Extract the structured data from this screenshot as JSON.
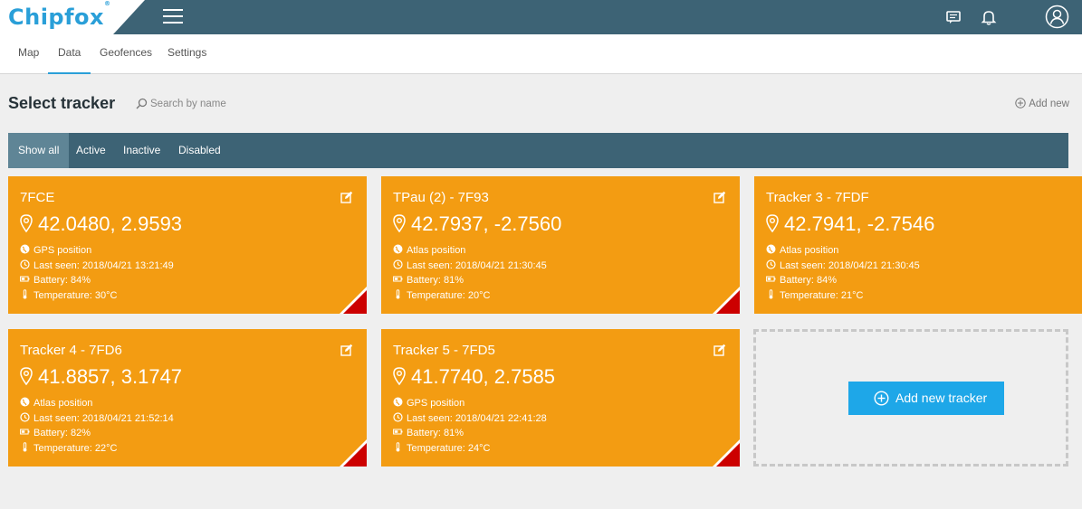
{
  "header": {
    "logo_text": "Chipfox",
    "logo_mark": "®",
    "icons": [
      "menu-icon",
      "chat-icon",
      "bell-icon",
      "user-icon"
    ]
  },
  "tabs": [
    {
      "label": "Map",
      "active": false
    },
    {
      "label": "Data",
      "active": true
    },
    {
      "label": "Geofences",
      "active": false
    },
    {
      "label": "Settings",
      "active": false
    }
  ],
  "page": {
    "title": "Select tracker",
    "search_placeholder": "Search by name",
    "add_new_label": "Add new"
  },
  "filters": [
    {
      "label": "Show all",
      "active": true
    },
    {
      "label": "Active",
      "active": false
    },
    {
      "label": "Inactive",
      "active": false
    },
    {
      "label": "Disabled",
      "active": false
    }
  ],
  "colors": {
    "header_bg": "#3d6375",
    "accent": "#2a9fd8",
    "card_bg": "#f39c12",
    "card_corner": "#cc0000",
    "add_button": "#1ea7e8"
  },
  "trackers": [
    {
      "name": "7FCE",
      "coords": "42.0480, 2.9593",
      "position_type": "GPS position",
      "last_seen": "Last seen: 2018/04/21 13:21:49",
      "battery": "Battery: 84%",
      "temperature": "Temperature: 30°C"
    },
    {
      "name": "TPau (2) - 7F93",
      "coords": "42.7937, -2.7560",
      "position_type": "Atlas position",
      "last_seen": "Last seen: 2018/04/21 21:30:45",
      "battery": "Battery: 81%",
      "temperature": "Temperature: 20°C"
    },
    {
      "name": "Tracker 3 - 7FDF",
      "coords": "42.7941, -2.7546",
      "position_type": "Atlas position",
      "last_seen": "Last seen: 2018/04/21 21:30:45",
      "battery": "Battery: 84%",
      "temperature": "Temperature: 21°C"
    },
    {
      "name": "Tracker 4 - 7FD6",
      "coords": "41.8857, 3.1747",
      "position_type": "Atlas position",
      "last_seen": "Last seen: 2018/04/21 21:52:14",
      "battery": "Battery: 82%",
      "temperature": "Temperature: 22°C"
    },
    {
      "name": "Tracker 5 - 7FD5",
      "coords": "41.7740, 2.7585",
      "position_type": "GPS position",
      "last_seen": "Last seen: 2018/04/21 22:41:28",
      "battery": "Battery: 81%",
      "temperature": "Temperature: 24°C"
    }
  ],
  "add_tracker": {
    "label": "Add new tracker"
  }
}
